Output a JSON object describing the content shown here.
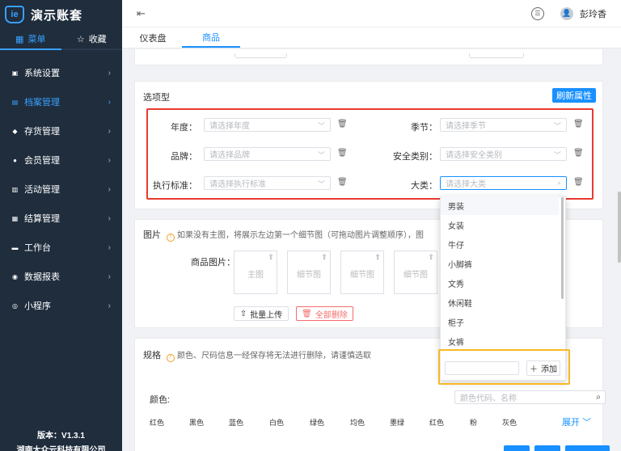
{
  "app": {
    "logo_glyph": "ie",
    "title": "演示账套"
  },
  "sidebar": {
    "tabs": [
      {
        "label": "菜单",
        "icon": "grid-icon",
        "active": true
      },
      {
        "label": "收藏",
        "icon": "star-icon",
        "active": false
      }
    ],
    "items": [
      {
        "label": "系统设置",
        "icon": "gear-icon"
      },
      {
        "label": "档案管理",
        "icon": "archive-icon",
        "active": true
      },
      {
        "label": "存货管理",
        "icon": "box-icon"
      },
      {
        "label": "会员管理",
        "icon": "member-icon"
      },
      {
        "label": "活动管理",
        "icon": "activity-icon"
      },
      {
        "label": "结算管理",
        "icon": "settle-icon"
      },
      {
        "label": "工作台",
        "icon": "desk-icon"
      },
      {
        "label": "数据报表",
        "icon": "report-icon"
      },
      {
        "label": "小程序",
        "icon": "miniapp-icon"
      }
    ],
    "version": "版本：V1.3.1",
    "company": "湖南大众云科技有限公司"
  },
  "topbar": {
    "user_name": "彭玲香",
    "avatar_glyph": "👤"
  },
  "page_tabs": [
    {
      "label": "仪表盘",
      "active": false
    },
    {
      "label": "商品",
      "active": true
    }
  ],
  "options_section": {
    "title": "选项型",
    "refresh_label": "刷新属性",
    "fields": [
      {
        "label": "年度：",
        "placeholder": "请选择年度"
      },
      {
        "label": "季节：",
        "placeholder": "请选择季节"
      },
      {
        "label": "品牌：",
        "placeholder": "请选择品牌"
      },
      {
        "label": "安全类别：",
        "placeholder": "请选择安全类别"
      },
      {
        "label": "执行标准：",
        "placeholder": "请选择执行标准"
      },
      {
        "label": "大类：",
        "placeholder": "请选择大类"
      }
    ]
  },
  "dropdown": {
    "items": [
      "男装",
      "女装",
      "牛仔",
      "小脚裤",
      "文秀",
      "休闲鞋",
      "柜子",
      "女裤"
    ],
    "add_label": "添加"
  },
  "image_section": {
    "title": "图片",
    "hint": "如果没有主图，将展示左边第一个细节图（可拖动图片调整顺序），图",
    "label": "商品图片：",
    "boxes": [
      "主图",
      "细节图",
      "细节图",
      "细节图"
    ],
    "batch_upload": "批量上传",
    "delete_all": "全部删除"
  },
  "spec_section": {
    "title": "规格",
    "hint": "颜色、尺码信息一经保存将无法进行删除，请谨慎选取",
    "color_label": "颜色:",
    "color_search_placeholder": "颜色代码、名称",
    "colors": [
      "红色",
      "黑色",
      "蓝色",
      "白色",
      "绿色",
      "均色",
      "墨绿",
      "红色",
      "粉",
      "灰色"
    ],
    "expand_label": "展开"
  }
}
